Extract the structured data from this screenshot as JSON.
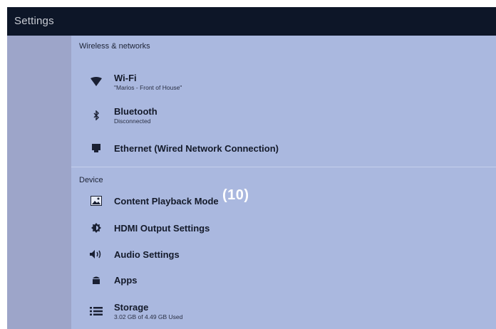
{
  "app": {
    "title": "Settings"
  },
  "sections": {
    "wireless": {
      "header": "Wireless & networks",
      "items": [
        {
          "label": "Wi-Fi",
          "sub": "\"Marios - Front of House\"",
          "icon": "wifi-icon"
        },
        {
          "label": "Bluetooth",
          "sub": "Disconnected",
          "icon": "bluetooth-icon"
        },
        {
          "label": "Ethernet (Wired Network Connection)",
          "icon": "ethernet-icon"
        }
      ]
    },
    "device": {
      "header": "Device",
      "items": [
        {
          "label": "Content Playback Mode",
          "icon": "image-icon"
        },
        {
          "label": "HDMI Output Settings",
          "icon": "brightness-icon"
        },
        {
          "label": "Audio Settings",
          "icon": "speaker-icon"
        },
        {
          "label": "Apps",
          "icon": "android-icon"
        },
        {
          "label": "Storage",
          "sub": "3.02 GB of 4.49 GB Used",
          "icon": "storage-list-icon"
        }
      ]
    }
  },
  "annotation": "(10)",
  "colors": {
    "titlebar": "#0d1628",
    "left_pane": "#9da5c9",
    "main_pane": "#aab8df",
    "annotation": "#ffffff"
  }
}
